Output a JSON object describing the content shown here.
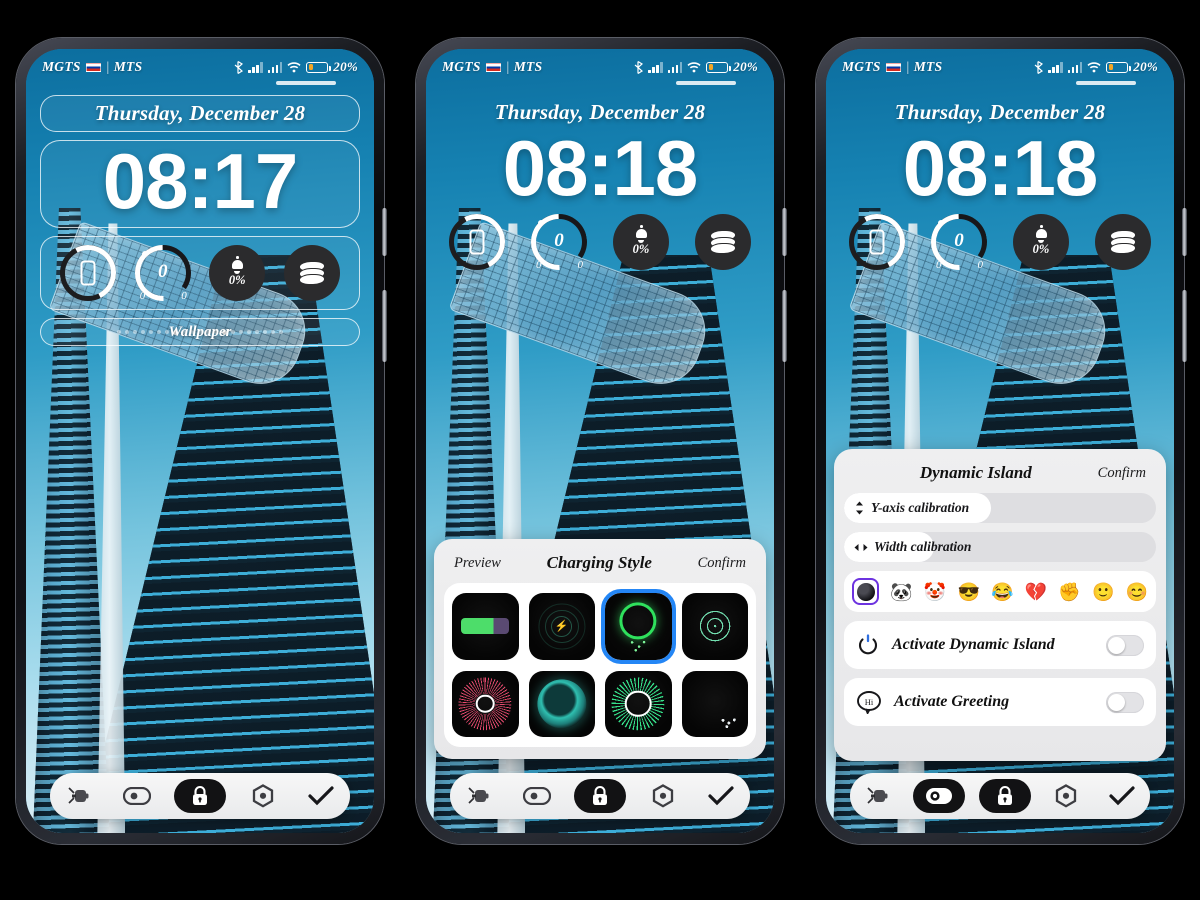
{
  "status_bar": {
    "carrier_1": "MGTS",
    "separator": "|",
    "carrier_2": "MTS",
    "battery_pct": "20%",
    "icons": [
      "bluetooth-icon",
      "signal-bars-icon",
      "signal-bars-icon",
      "wifi-icon",
      "battery-icon"
    ]
  },
  "panels": [
    {
      "id": "panel-edit-widgets",
      "date": "Thursday, December 28",
      "time": "08:17",
      "edit_mode": true,
      "wallpaper_label": "Wallpaper",
      "widgets": [
        {
          "name": "phone-ring-widget",
          "label": ""
        },
        {
          "name": "gauge-widget",
          "value": "0",
          "min": "0",
          "max": "0"
        },
        {
          "name": "notification-widget",
          "value": "0%"
        },
        {
          "name": "layers-widget",
          "label": ""
        }
      ]
    },
    {
      "id": "panel-charging-style",
      "date": "Thursday, December 28",
      "time": "08:18",
      "edit_mode": false
    },
    {
      "id": "panel-dynamic-island",
      "date": "Thursday, December 28",
      "time": "08:18",
      "edit_mode": false
    }
  ],
  "toolbar": {
    "items": [
      {
        "name": "charging-icon",
        "label": "Charging",
        "active": false
      },
      {
        "name": "capsule-icon",
        "label": "Dynamic Island",
        "active": false
      },
      {
        "name": "lock-icon",
        "label": "Lock Screen",
        "active": true
      },
      {
        "name": "nut-icon",
        "label": "Settings",
        "active": false
      },
      {
        "name": "checkmark-icon",
        "label": "Apply",
        "active": false
      }
    ],
    "toolbar_3_active": [
      "capsule-icon",
      "lock-icon"
    ]
  },
  "charging_sheet": {
    "preview_label": "Preview",
    "title": "Charging Style",
    "confirm_label": "Confirm",
    "selected_index": 2,
    "selected_accent": "#2486f5",
    "styles": [
      {
        "name": "battery-bar-style",
        "kind": "batt"
      },
      {
        "name": "pulse-rings-style",
        "kind": "rings"
      },
      {
        "name": "green-ring-style",
        "kind": "greenring"
      },
      {
        "name": "dot-fan-style",
        "kind": "dotfan"
      },
      {
        "name": "pink-burst-style",
        "kind": "burst"
      },
      {
        "name": "teal-blob-style",
        "kind": "tealblob"
      },
      {
        "name": "green-dot-ring-style",
        "kind": "dotring"
      },
      {
        "name": "minimal-dark-style",
        "kind": "plaindots"
      }
    ]
  },
  "island_sheet": {
    "title": "Dynamic Island",
    "confirm_label": "Confirm",
    "sliders": [
      {
        "name": "y-axis-calibration-slider",
        "label": "Y-axis calibration",
        "icon": "up-down-arrows-icon",
        "fill_pct": 47
      },
      {
        "name": "width-calibration-slider",
        "label": "Width calibration",
        "icon": "left-right-arrows-icon",
        "fill_pct": 29
      }
    ],
    "emoji_selected_index": 0,
    "emoji_selected_accent": "#6d33e0",
    "emojis": [
      {
        "name": "camera-lens-icon",
        "glyph": ""
      },
      {
        "name": "panda-emoji",
        "glyph": "🐼"
      },
      {
        "name": "clown-emoji",
        "glyph": "🤡"
      },
      {
        "name": "sunglasses-emoji",
        "glyph": "😎"
      },
      {
        "name": "joy-emoji",
        "glyph": "😂"
      },
      {
        "name": "broken-heart-emoji",
        "glyph": "💔"
      },
      {
        "name": "raised-fist-emoji",
        "glyph": "✊"
      },
      {
        "name": "smile-emoji",
        "glyph": "🙂"
      },
      {
        "name": "blush-emoji",
        "glyph": "😊"
      }
    ],
    "toggles": [
      {
        "name": "activate-dynamic-island-toggle",
        "label": "Activate Dynamic Island",
        "icon": "power-icon",
        "on": false
      },
      {
        "name": "activate-greeting-toggle",
        "label": "Activate Greeting",
        "icon": "hi-bubble-icon",
        "on": false,
        "icon_text": "Hi"
      }
    ]
  }
}
